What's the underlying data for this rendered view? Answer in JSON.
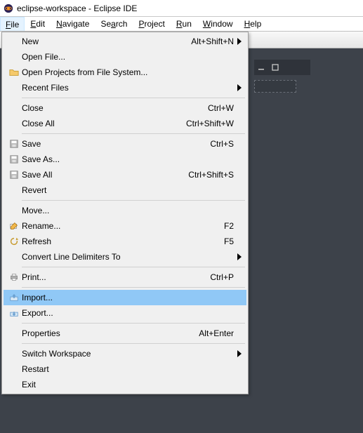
{
  "window": {
    "title": "eclipse-workspace - Eclipse IDE"
  },
  "menubar": {
    "items": [
      {
        "label": "File",
        "key": "F",
        "open": true
      },
      {
        "label": "Edit",
        "key": "E"
      },
      {
        "label": "Navigate",
        "key": "N"
      },
      {
        "label": "Search",
        "key": "a"
      },
      {
        "label": "Project",
        "key": "P"
      },
      {
        "label": "Run",
        "key": "R"
      },
      {
        "label": "Window",
        "key": "W"
      },
      {
        "label": "Help",
        "key": "H"
      }
    ]
  },
  "toolbar": {
    "items": [
      "new",
      "save",
      "save-all",
      "skip-breakpoints",
      "resume",
      "suspend",
      "terminate",
      "run-last",
      "debug-last",
      "coverage",
      "external-tools",
      "search"
    ]
  },
  "file_menu": {
    "groups": [
      [
        {
          "id": "new",
          "label": "New",
          "shortcut": "Alt+Shift+N",
          "submenu": true,
          "icon": null
        },
        {
          "id": "open-file",
          "label": "Open File...",
          "icon": null
        },
        {
          "id": "open-projects",
          "label": "Open Projects from File System...",
          "icon": "folder"
        },
        {
          "id": "recent-files",
          "label": "Recent Files",
          "submenu": true,
          "icon": null
        }
      ],
      [
        {
          "id": "close",
          "label": "Close",
          "shortcut": "Ctrl+W",
          "icon": null
        },
        {
          "id": "close-all",
          "label": "Close All",
          "shortcut": "Ctrl+Shift+W",
          "icon": null
        }
      ],
      [
        {
          "id": "save",
          "label": "Save",
          "shortcut": "Ctrl+S",
          "icon": "save"
        },
        {
          "id": "save-as",
          "label": "Save As...",
          "icon": "save-as"
        },
        {
          "id": "save-all",
          "label": "Save All",
          "shortcut": "Ctrl+Shift+S",
          "icon": "save-all"
        },
        {
          "id": "revert",
          "label": "Revert",
          "icon": null
        }
      ],
      [
        {
          "id": "move",
          "label": "Move...",
          "icon": null
        },
        {
          "id": "rename",
          "label": "Rename...",
          "shortcut": "F2",
          "icon": "rename"
        },
        {
          "id": "refresh",
          "label": "Refresh",
          "shortcut": "F5",
          "icon": "refresh"
        },
        {
          "id": "convert-delims",
          "label": "Convert Line Delimiters To",
          "submenu": true,
          "icon": null
        }
      ],
      [
        {
          "id": "print",
          "label": "Print...",
          "shortcut": "Ctrl+P",
          "icon": "print"
        }
      ],
      [
        {
          "id": "import",
          "label": "Import...",
          "icon": "import",
          "highlight": true
        },
        {
          "id": "export",
          "label": "Export...",
          "icon": "export"
        }
      ],
      [
        {
          "id": "properties",
          "label": "Properties",
          "shortcut": "Alt+Enter",
          "icon": null
        }
      ],
      [
        {
          "id": "switch-ws",
          "label": "Switch Workspace",
          "submenu": true,
          "icon": null
        },
        {
          "id": "restart",
          "label": "Restart",
          "icon": null
        },
        {
          "id": "exit",
          "label": "Exit",
          "icon": null
        }
      ]
    ]
  },
  "colors": {
    "highlight": "#90c8f6",
    "menubg": "#f0f0f0",
    "dark": "#3d424a"
  }
}
